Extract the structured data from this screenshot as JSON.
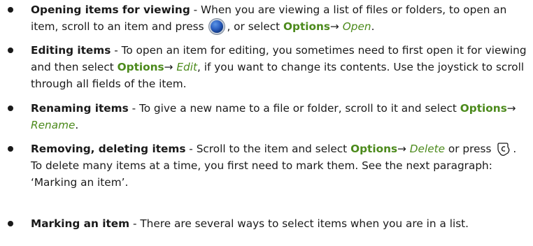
{
  "sep": " - ",
  "arrow": "→",
  "items": [
    {
      "term": "Opening items for viewing",
      "a": "When you are viewing a list of files or folders, to open an item, scroll to an item and press",
      "b": ", or select",
      "opt": "Options",
      "cmd": "Open",
      "end": "."
    },
    {
      "term": "Editing items",
      "a": "To open an item for editing, you sometimes need to first open it for viewing and then select",
      "opt": "Options",
      "cmd": "Edit",
      "b": ", if you want to change its contents. Use the joystick to scroll through all fields of the item."
    },
    {
      "term": "Renaming items",
      "a": "To give a new name to a file or folder, scroll to it and select",
      "opt": "Options",
      "cmd": "Rename",
      "end": "."
    },
    {
      "term": "Removing, deleting items",
      "a": "Scroll to the item and select",
      "opt": "Options",
      "cmd": "Delete",
      "b": "or press",
      "c": ". To delete many items at a time, you first need to mark them. See the next paragraph: ‘Marking an item’."
    },
    {
      "term": "Marking an item",
      "a": "There are several ways to select items when you are in a list."
    }
  ],
  "icons": {
    "select_key": "joystick-select-icon",
    "clear_key": "clear-key-icon"
  }
}
